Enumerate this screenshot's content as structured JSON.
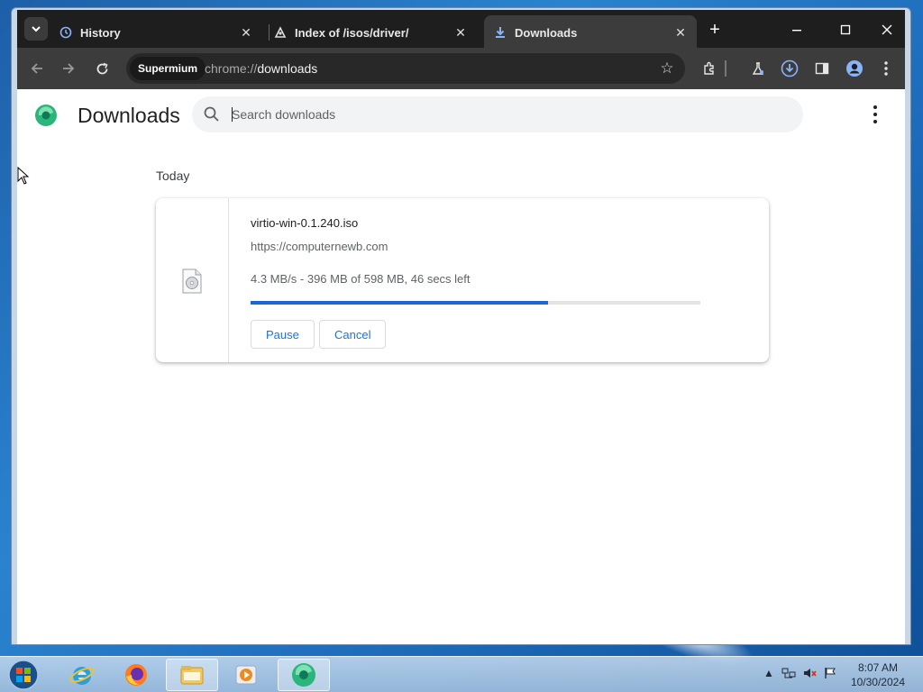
{
  "browser": {
    "tabs": [
      {
        "title": "History",
        "icon": "history-icon",
        "close": "✕"
      },
      {
        "title": "Index of /isos/driver/",
        "icon": "site-favicon",
        "close": "✕"
      },
      {
        "title": "Downloads",
        "icon": "download-icon",
        "close": "✕",
        "active": true
      }
    ],
    "new_tab": "+",
    "omnibox": {
      "chip": "Supermium",
      "scheme": "chrome://",
      "host": "downloads"
    }
  },
  "page": {
    "title": "Downloads",
    "search_placeholder": "Search downloads",
    "date_heading": "Today",
    "download": {
      "file_name": "virtio-win-0.1.240.iso",
      "url": "https://computernewb.com",
      "progress_text": "4.3 MB/s - 396 MB of 598 MB, 46 secs left",
      "progress_fraction": 0.662,
      "pause_label": "Pause",
      "cancel_label": "Cancel"
    }
  },
  "taskbar": {
    "apps": [
      "internet-explorer-icon",
      "firefox-icon",
      "file-explorer-icon",
      "media-player-icon",
      "supermium-icon"
    ],
    "time": "8:07 AM",
    "date": "10/30/2024"
  },
  "colors": {
    "accent": "#1a73e8",
    "titlebar": "#1e1e1e",
    "toolbar": "#3c3c3c"
  }
}
